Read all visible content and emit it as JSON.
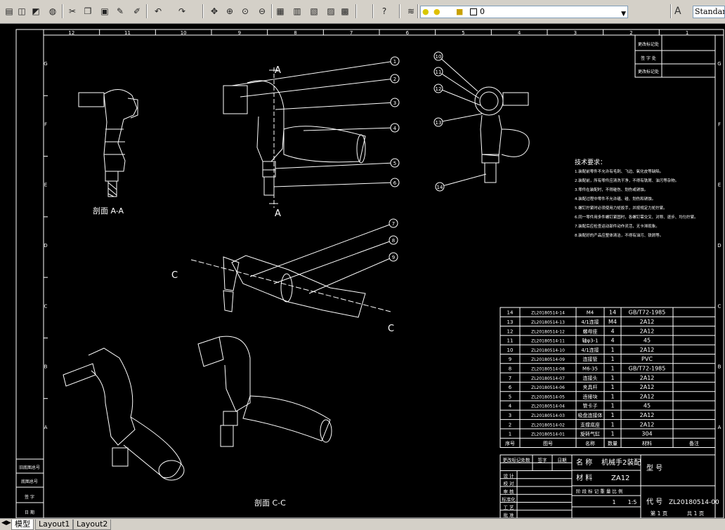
{
  "toolbar": {
    "buttons": [
      "open-icon",
      "preview-icon",
      "publish-icon",
      "globe-icon",
      "cut-icon",
      "copy-icon",
      "paste-icon",
      "match-properties-icon",
      "brush-icon",
      "undo-icon",
      "redo-icon",
      "pan-icon",
      "zoom-realtime-icon",
      "zoom-window-icon",
      "zoom-previous-icon",
      "properties-icon",
      "design-center-icon",
      "tool-palettes-icon",
      "markup-icon",
      "calculator-icon",
      "help-icon",
      "layer-manager-icon"
    ],
    "layer_value": "0",
    "text_style": "Standard"
  },
  "tabs": {
    "model": "模型",
    "layout1": "Layout1",
    "layout2": "Layout2"
  },
  "drawing": {
    "ruler_top": [
      "12",
      "11",
      "10",
      "9",
      "8",
      "7",
      "6",
      "5",
      "4",
      "3",
      "2",
      "1"
    ],
    "ruler_side": [
      "G",
      "F",
      "E",
      "D",
      "C",
      "B",
      "A"
    ],
    "section_a_label": "剖面 A-A",
    "section_c_label": "剖面 C-C",
    "cut_a": "A",
    "cut_c": "C",
    "callouts": [
      "1",
      "2",
      "3",
      "4",
      "5",
      "6",
      "7",
      "8",
      "9",
      "10",
      "11",
      "12",
      "13",
      "14"
    ],
    "tech_title": "技术要求：",
    "tech_lines": [
      "1.装配前零件不允许有毛刺、飞边、氧化皮等缺陷。",
      "2.装配前，所有零件应清洗干净，不得有铁屑、油污等杂物。",
      "3.零件在装配时，不得碰伤、划伤或锈蚀。",
      "4.装配过程中零件不允许磕、碰、划伤和锈蚀。",
      "5.螺钉拧紧时必须使用力矩扳手，并按规定力矩拧紧。",
      "6.同一零件用多件螺钉紧固时，各螺钉需交叉、对称、逐步、均匀拧紧。",
      "7.装配后应检查运动部件动作灵活，无卡滞现象。",
      "8.装配好的产品应整体清洁，不得有油污、铁屑等。"
    ],
    "bom_header": {
      "no": "序号",
      "code": "图号",
      "name": "名称",
      "qty": "数量",
      "material": "材料",
      "remark": "备注"
    },
    "bom": [
      {
        "no": "14",
        "code": "ZL20180514-14",
        "name": "M4",
        "qty": "14",
        "material": "GB/T72-1985"
      },
      {
        "no": "13",
        "code": "ZL20180514-13",
        "name": "4/1连接",
        "qty": "M4",
        "material": "2A12"
      },
      {
        "no": "12",
        "code": "ZL20180514-12",
        "name": "螺母座",
        "qty": "4",
        "material": "2A12"
      },
      {
        "no": "11",
        "code": "ZL20180514-11",
        "name": "轴φ3-1",
        "qty": "4",
        "material": "45"
      },
      {
        "no": "10",
        "code": "ZL20180514-10",
        "name": "4/1连接",
        "qty": "1",
        "material": "2A12"
      },
      {
        "no": "9",
        "code": "ZL20180514-09",
        "name": "连接管",
        "qty": "1",
        "material": "PVC"
      },
      {
        "no": "8",
        "code": "ZL20180514-08",
        "name": "M6-35",
        "qty": "1",
        "material": "GB/T72-1985"
      },
      {
        "no": "7",
        "code": "ZL20180514-07",
        "name": "连接头",
        "qty": "1",
        "material": "2A12"
      },
      {
        "no": "6",
        "code": "ZL20180514-06",
        "name": "夹具杆",
        "qty": "1",
        "material": "2A12"
      },
      {
        "no": "5",
        "code": "ZL20180514-05",
        "name": "连接块",
        "qty": "1",
        "material": "2A12"
      },
      {
        "no": "4",
        "code": "ZL20180514-04",
        "name": "管卡子",
        "qty": "1",
        "material": "45"
      },
      {
        "no": "3",
        "code": "ZL20180514-03",
        "name": "吸盘连接体",
        "qty": "1",
        "material": "2A12"
      },
      {
        "no": "2",
        "code": "ZL20180514-02",
        "name": "支撑底座",
        "qty": "1",
        "material": "2A12"
      },
      {
        "no": "1",
        "code": "ZL20180514-01",
        "name": "旋转气缸",
        "qty": "1",
        "material": "304"
      }
    ],
    "title_block": {
      "name_label": "名 称",
      "name_value": "机械手2装配",
      "material_label": "材 料",
      "material_value": "ZA12",
      "model_label": "型 号",
      "code_label": "代 号",
      "code_value": "ZL20180514-00",
      "change_labels": [
        "更改标记处数",
        "签字",
        "日期"
      ],
      "roles": [
        "设 计",
        "校 对",
        "审 核",
        "标准化",
        "工 艺",
        "批 准"
      ],
      "stage_label": "阶 段 标 记 重 量 比 例",
      "qty": "1",
      "scale": "1:5",
      "sheet": "第 1 页",
      "total": "共 1 页"
    },
    "left_strip": [
      "旧底图总号",
      "底图总号",
      "签 字",
      "日 期"
    ],
    "top_right": [
      "更改标记处",
      "签 字 处",
      "更改标记处"
    ]
  }
}
